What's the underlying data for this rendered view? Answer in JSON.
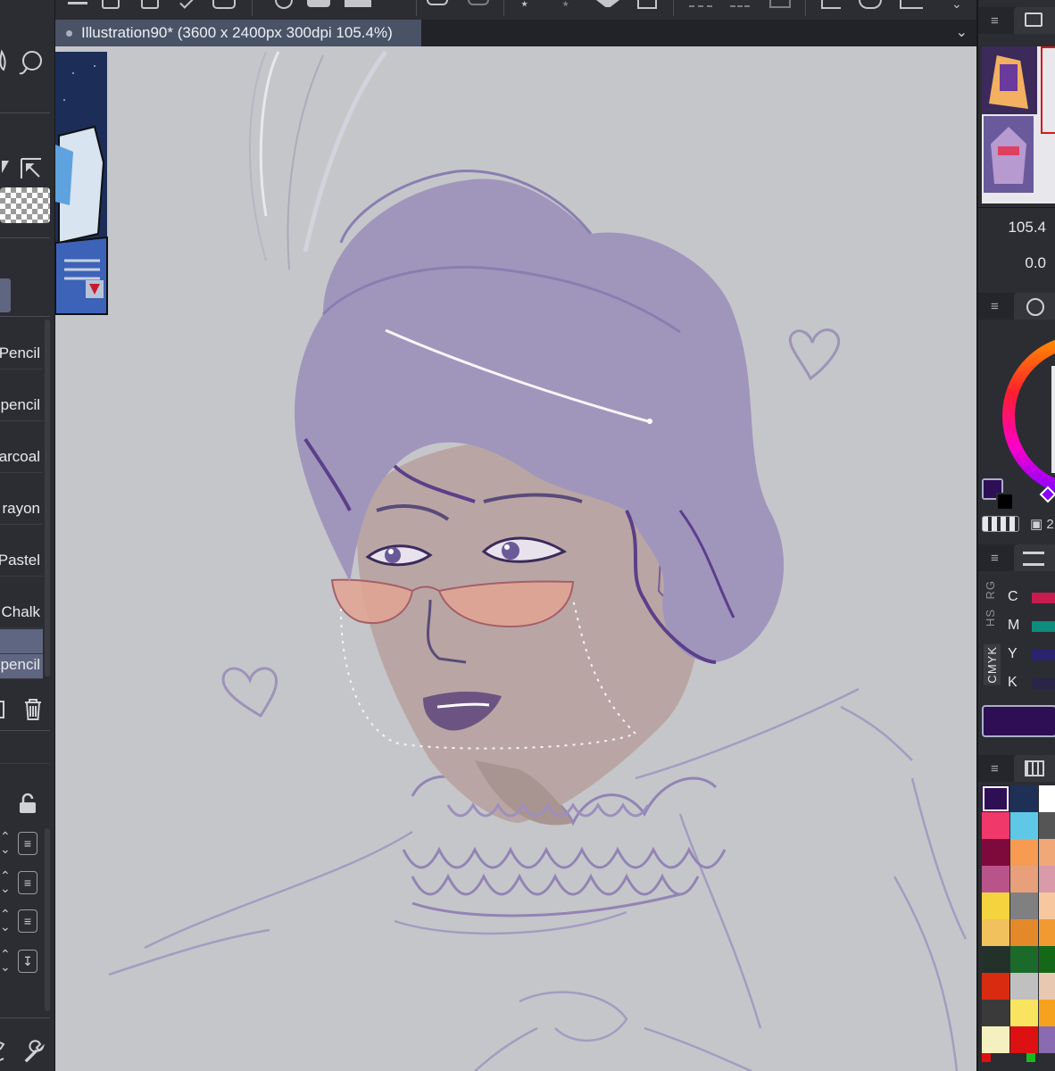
{
  "document": {
    "tab_title": "Illustration90* (3600 x 2400px 300dpi 105.4%)"
  },
  "brushes": [
    {
      "label": "Pencil",
      "selected": false
    },
    {
      "label": "pencil",
      "selected": false
    },
    {
      "label": "arcoal",
      "selected": false
    },
    {
      "label": "rayon",
      "selected": false
    },
    {
      "label": "Pastel",
      "selected": false
    },
    {
      "label": "Chalk",
      "selected": false
    },
    {
      "label": "",
      "selected": true
    },
    {
      "label": "pencil",
      "selected": true
    }
  ],
  "navigator": {
    "zoom": "105.4",
    "rotation": "0.0"
  },
  "color_wheel": {
    "size_label": "2",
    "main_color": "#2e0f55",
    "sub_color": "#000000"
  },
  "color_slider": {
    "tabs": [
      "RG",
      "HS",
      "CMYK"
    ],
    "channels": [
      {
        "label": "C",
        "color": "#c81c4e"
      },
      {
        "label": "M",
        "color": "#0e8c7d"
      },
      {
        "label": "Y",
        "color": "#2a2470"
      },
      {
        "label": "K",
        "color": "#2a2547"
      }
    ],
    "current_color": "#2e0f55"
  },
  "palette": {
    "colors": [
      "#2e0f55",
      "#1f3057",
      "#ffffff",
      "#f0386a",
      "#5ec8e6",
      "#555555",
      "#7d0a3a",
      "#f79a52",
      "#f0a878",
      "#b8548a",
      "#e8a07a",
      "#d99aaa",
      "#f5d33e",
      "#808080",
      "#f7c8a0",
      "#f1c15e",
      "#e4892a",
      "#f29a32",
      "#22312a",
      "#1b6a2a",
      "#146818",
      "#d92b0f",
      "#c0c0c0",
      "#e8c8b0",
      "#3a3a3a",
      "#f9e460",
      "#f7a21e",
      "#f5f0c0",
      "#dd1111",
      "#8a6ab0"
    ]
  },
  "colors": {
    "panel_bg": "#2b2d32",
    "canvas_bg": "#c5c6ca",
    "accent": "#5f6681"
  }
}
